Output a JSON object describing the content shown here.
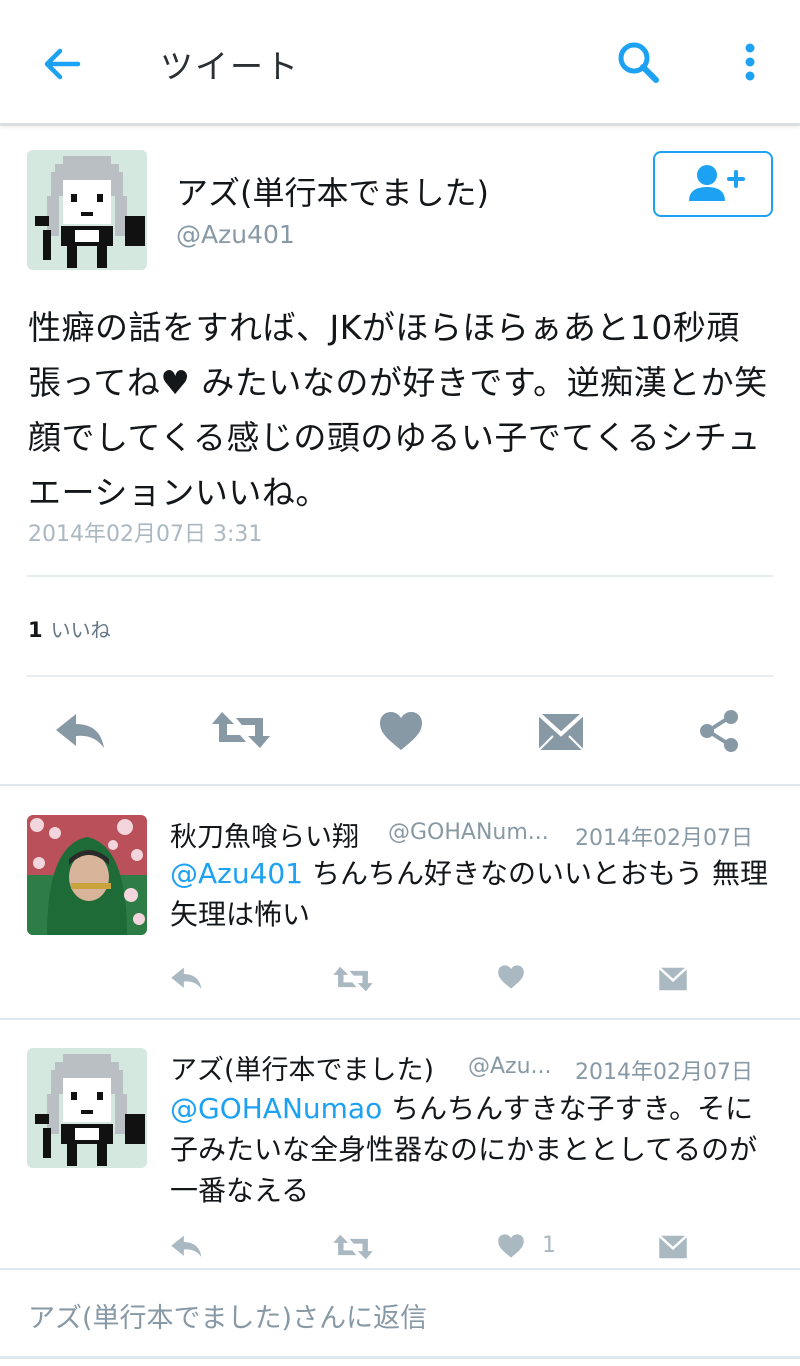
{
  "topbar": {
    "title": "ツイート"
  },
  "tweet": {
    "author_name": "アズ(単行本でました)",
    "author_handle": "@Azu401",
    "text": "性癖の話をすれば、JKがほらほらぁあと10秒頑張ってね♥ みたいなのが好きです。逆痴漢とか笑顔でしてくる感じの頭のゆるい子でてくるシチュエーションいいね。",
    "timestamp": "2014年02月07日 3:31",
    "likes_count": "1",
    "likes_label": "いいね"
  },
  "replies": [
    {
      "name": "秋刀魚喰らい翔",
      "handle": "@GOHANum...",
      "date": "2014年02月07日",
      "mention": "@Azu401",
      "text": " ちんちん好きなのいいとおもう 無理矢理は怖い",
      "like_count": ""
    },
    {
      "name": "アズ(単行本でました)",
      "handle": "@Azu...",
      "date": "2014年02月07日",
      "mention": "@GOHANumao",
      "text": " ちんちんすきな子すき。そに子みたいな全身性器なのにかまととしてるのが一番なえる",
      "like_count": "1"
    }
  ],
  "reply_bar": {
    "placeholder": "アズ(単行本でました)さんに返信"
  },
  "colors": {
    "accent": "#1da1f2",
    "icon_gray": "#8899a6",
    "light_gray": "#aab8c2"
  }
}
